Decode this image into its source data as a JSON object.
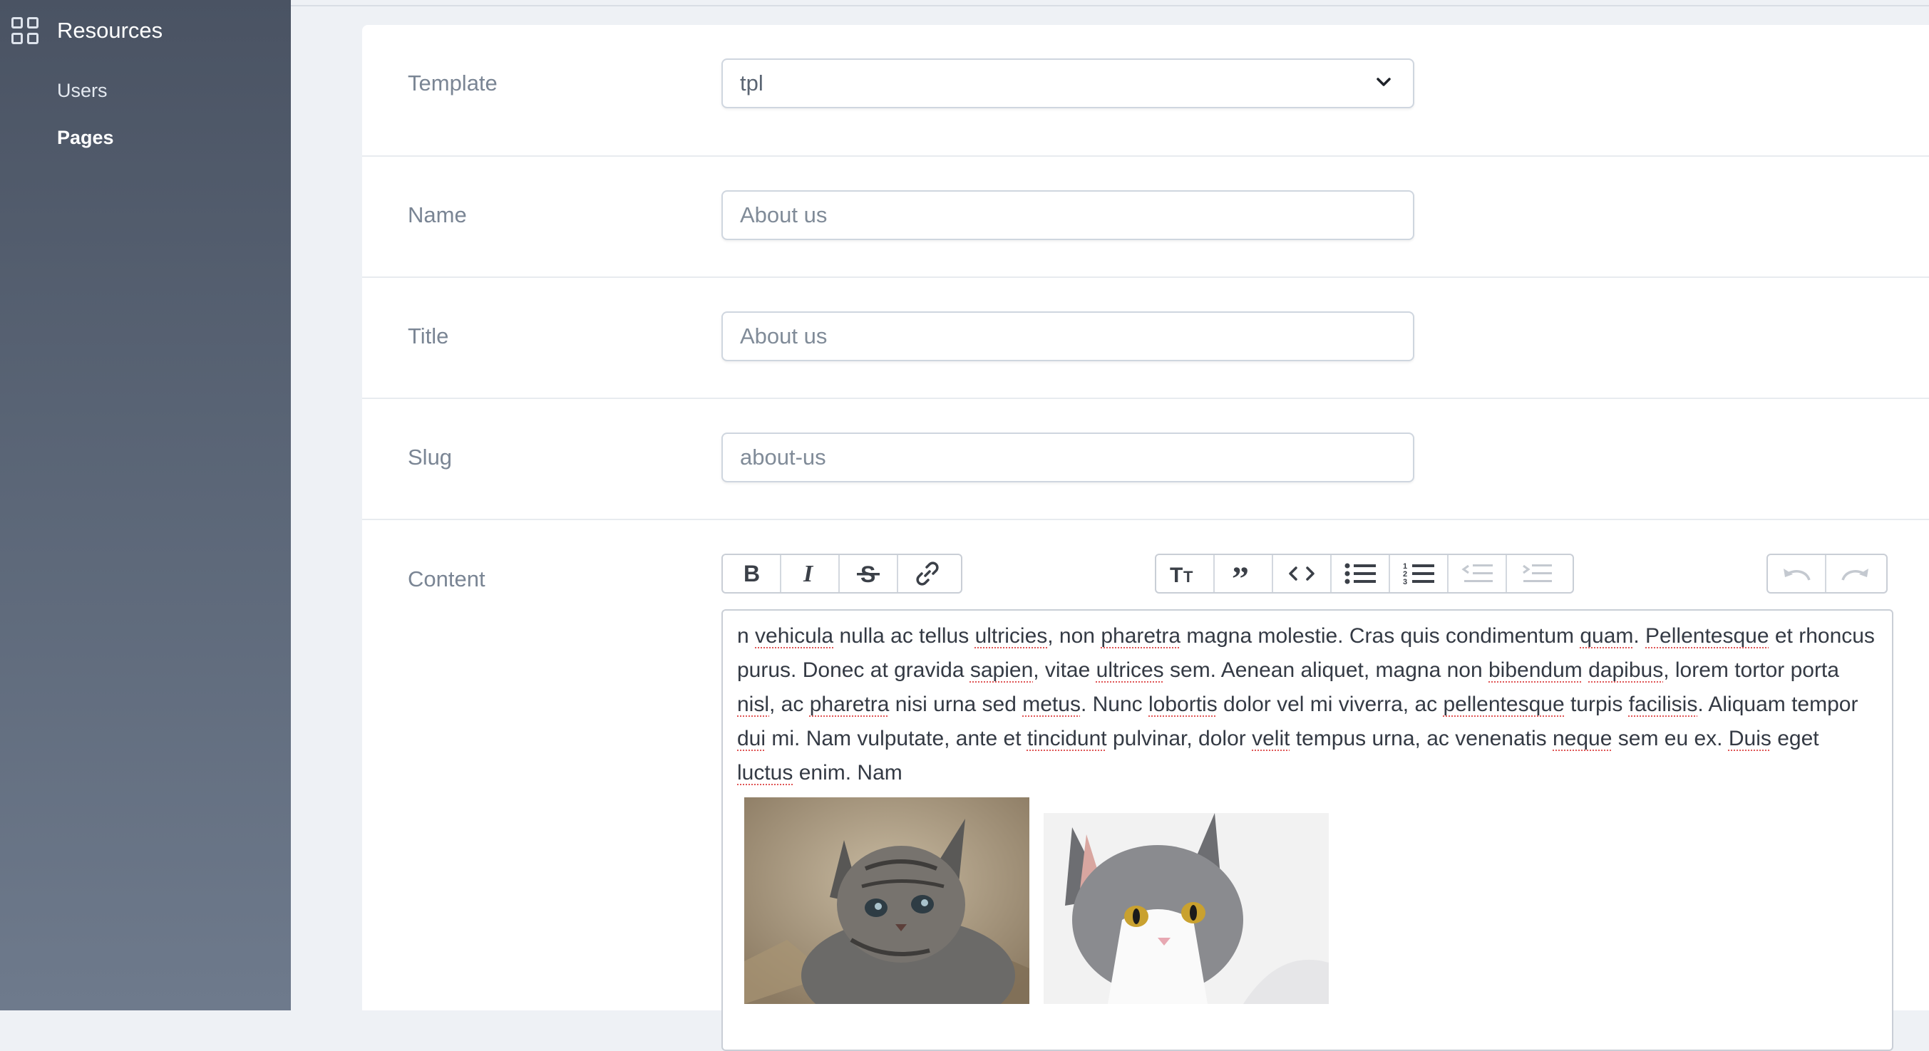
{
  "sidebar": {
    "brand": {
      "label": "Resources",
      "icon": "grid-icon"
    },
    "items": [
      {
        "label": "Users",
        "active": false
      },
      {
        "label": "Pages",
        "active": true
      }
    ]
  },
  "form": {
    "template": {
      "label": "Template",
      "value": "tpl"
    },
    "name": {
      "label": "Name",
      "value": "About us"
    },
    "title": {
      "label": "Title",
      "value": "About us"
    },
    "slug": {
      "label": "Slug",
      "value": "about-us"
    },
    "content": {
      "label": "Content",
      "toolbar": {
        "text_tools": [
          "bold-icon",
          "italic-icon",
          "strikethrough-icon",
          "link-icon"
        ],
        "block_tools": [
          "heading-icon",
          "quote-icon",
          "code-icon",
          "bullet-list-icon",
          "numbered-list-icon",
          "outdent-icon",
          "indent-icon"
        ],
        "history_tools": [
          "undo-icon",
          "redo-icon"
        ]
      },
      "text": {
        "w1": "n ",
        "s1": "vehicula",
        "w2": " nulla ac tellus ",
        "s2": "ultricies",
        "w3": ", non ",
        "s3": "pharetra",
        "w4": " magna molestie. Cras quis condimentum ",
        "s4": "quam",
        "w5": ". ",
        "s5": "Pellentesque",
        "w6": " et rhoncus purus. Donec at gravida ",
        "s6": "sapien",
        "w7": ", vitae ",
        "s7": "ultrices",
        "w8": " sem. Aenean aliquet, magna non ",
        "s8": "bibendum",
        "w9": " ",
        "s9": "dapibus",
        "w10": ", lorem tortor porta ",
        "s10": "nisl",
        "w11": ", ac ",
        "s11": "pharetra",
        "w12": " nisi urna sed ",
        "s12": "metus",
        "w13": ". Nunc ",
        "s13": "lobortis",
        "w14": " dolor vel mi viverra, ac ",
        "s14": "pellentesque",
        "w15": " turpis ",
        "s15": "facilisis",
        "w16": ". Aliquam tempor ",
        "s16": "dui",
        "w17": " mi. Nam vulputate, ante et ",
        "s17": "tincidunt",
        "w18": " pulvinar, dolor ",
        "s18": "velit",
        "w19": " tempus urna, ac venenatis ",
        "s19": "neque",
        "w20": " sem eu ex. ",
        "s20": "Duis",
        "w21": " eget ",
        "s21": "luctus",
        "w22": " enim. Nam"
      },
      "images": [
        "tabby-kitten-photo",
        "gray-white-cat-photo"
      ]
    }
  },
  "colors": {
    "sidebar": "#4a5363",
    "background": "#eef1f5",
    "spellcheck": "#e05656"
  }
}
